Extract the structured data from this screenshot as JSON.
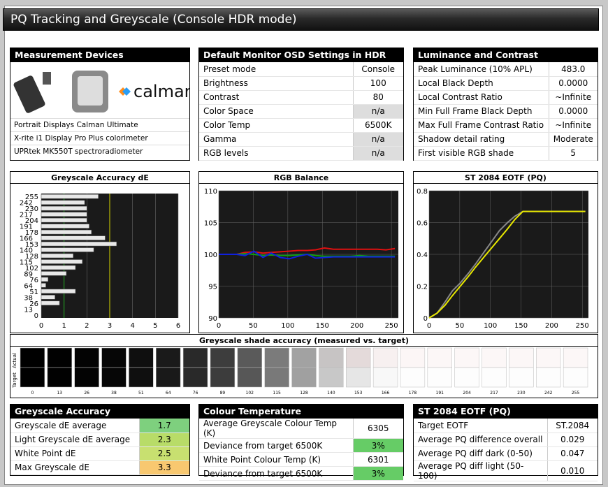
{
  "title": "PQ Tracking and Greyscale (Console HDR mode)",
  "devices": {
    "header": "Measurement Devices",
    "logo_text": "calman",
    "items": [
      "Portrait Displays Calman Ultimate",
      "X-rite i1 Display Pro Plus colorimeter",
      "UPRtek MK550T spectroradiometer"
    ]
  },
  "osd": {
    "header": "Default Monitor OSD Settings in HDR mode",
    "rows": [
      {
        "label": "Preset mode",
        "value": "Console",
        "na": false
      },
      {
        "label": "Brightness",
        "value": "100",
        "na": false
      },
      {
        "label": "Contrast",
        "value": "80",
        "na": false
      },
      {
        "label": "Color Space",
        "value": "n/a",
        "na": true
      },
      {
        "label": "Color Temp",
        "value": "6500K",
        "na": false
      },
      {
        "label": "Gamma",
        "value": "n/a",
        "na": true
      },
      {
        "label": "RGB levels",
        "value": "n/a",
        "na": true
      }
    ]
  },
  "lum": {
    "header": "Luminance and Contrast",
    "rows": [
      {
        "label": "Peak Luminance (10% APL)",
        "value": "483.0"
      },
      {
        "label": "Local Black Depth",
        "value": "0.0000"
      },
      {
        "label": "Local Contrast Ratio",
        "value": "~Infinite"
      },
      {
        "label": "Min Full Frame Black Depth",
        "value": "0.0000"
      },
      {
        "label": "Max Full Frame Contrast Ratio",
        "value": "~Infinite"
      },
      {
        "label": "Shadow detail rating",
        "value": "Moderate"
      },
      {
        "label": "First visible RGB shade",
        "value": "5"
      }
    ]
  },
  "chart_data": [
    {
      "type": "bar",
      "title": "Greyscale Accuracy dE",
      "categories": [
        "0",
        "13",
        "26",
        "38",
        "51",
        "64",
        "76",
        "89",
        "102",
        "115",
        "128",
        "140",
        "153",
        "166",
        "178",
        "191",
        "204",
        "217",
        "230",
        "242",
        "255"
      ],
      "values": [
        0,
        0,
        0.8,
        0.6,
        1.5,
        0.2,
        0.3,
        1.1,
        1.5,
        1.8,
        1.4,
        2.3,
        3.3,
        2.8,
        2.2,
        2.1,
        2.0,
        2.0,
        2.0,
        1.9,
        2.5
      ],
      "xlim": [
        0,
        6
      ],
      "xticks": [
        0,
        1,
        2,
        3,
        4,
        5,
        6
      ],
      "ref_lines": [
        {
          "x": 1,
          "color": "#22aa22"
        },
        {
          "x": 3,
          "color": "#d8d800"
        }
      ]
    },
    {
      "type": "line",
      "title": "RGB Balance",
      "x": [
        0,
        13,
        26,
        38,
        51,
        64,
        76,
        89,
        102,
        115,
        128,
        140,
        153,
        166,
        178,
        191,
        204,
        217,
        230,
        242,
        255
      ],
      "series": [
        {
          "color": "#e01010",
          "values": [
            100,
            100,
            100,
            100.3,
            100.4,
            100.2,
            100.3,
            100.4,
            100.5,
            100.6,
            100.6,
            100.7,
            101.0,
            100.8,
            100.8,
            100.8,
            100.8,
            100.8,
            100.8,
            100.7,
            100.9
          ]
        },
        {
          "color": "#10a010",
          "values": [
            100,
            100,
            100,
            100.1,
            100,
            99.8,
            99.9,
            99.8,
            99.8,
            99.9,
            100,
            99.8,
            99.7,
            99.7,
            99.7,
            99.7,
            99.8,
            99.7,
            99.7,
            99.7,
            99.7
          ]
        },
        {
          "color": "#1020e0",
          "values": [
            100,
            100,
            100,
            99.8,
            100.5,
            99.5,
            100.2,
            99.5,
            99.3,
            99.7,
            100.0,
            99.4,
            99.5,
            99.6,
            99.6,
            99.6,
            99.6,
            99.6,
            99.6,
            99.6,
            99.6
          ]
        }
      ],
      "ylim": [
        90,
        110
      ],
      "yticks": [
        90,
        95,
        100,
        105,
        110
      ],
      "xticks": [
        0,
        50,
        100,
        150,
        200,
        250
      ]
    },
    {
      "type": "line",
      "title": "ST 2084 EOTF (PQ)",
      "x": [
        0,
        13,
        26,
        38,
        51,
        64,
        76,
        89,
        102,
        115,
        128,
        140,
        153,
        166,
        178,
        191,
        204,
        217,
        230,
        242,
        255
      ],
      "series": [
        {
          "color": "#888888",
          "values": [
            0,
            0.03,
            0.1,
            0.17,
            0.22,
            0.28,
            0.34,
            0.41,
            0.48,
            0.55,
            0.6,
            0.64,
            0.67,
            0.67,
            0.67,
            0.67,
            0.67,
            0.67,
            0.67,
            0.67,
            0.67
          ]
        },
        {
          "color": "#e8e800",
          "values": [
            0,
            0.03,
            0.08,
            0.14,
            0.2,
            0.26,
            0.32,
            0.38,
            0.44,
            0.5,
            0.56,
            0.62,
            0.67,
            0.67,
            0.67,
            0.67,
            0.67,
            0.67,
            0.67,
            0.67,
            0.67
          ]
        }
      ],
      "ylim": [
        0,
        0.8
      ],
      "yticks": [
        0,
        0.2,
        0.4,
        0.6,
        0.8
      ],
      "xticks": [
        0,
        50,
        100,
        150,
        200,
        250
      ]
    }
  ],
  "shades": {
    "title": "Greyscale shade accuracy (measured vs. target)",
    "actual_label": "Actual",
    "target_label": "Target",
    "items": [
      {
        "label": "0",
        "actual": "#000000",
        "target": "#000000"
      },
      {
        "label": "13",
        "actual": "#010101",
        "target": "#010101"
      },
      {
        "label": "26",
        "actual": "#030303",
        "target": "#030303"
      },
      {
        "label": "38",
        "actual": "#060606",
        "target": "#060606"
      },
      {
        "label": "51",
        "actual": "#0f0f0f",
        "target": "#0f0f0f"
      },
      {
        "label": "64",
        "actual": "#1a1a1a",
        "target": "#191919"
      },
      {
        "label": "76",
        "actual": "#292929",
        "target": "#292929"
      },
      {
        "label": "89",
        "actual": "#3d3d3d",
        "target": "#3c3c3c"
      },
      {
        "label": "102",
        "actual": "#5a5a5a",
        "target": "#575757"
      },
      {
        "label": "115",
        "actual": "#7b7b7b",
        "target": "#797979"
      },
      {
        "label": "128",
        "actual": "#a2a2a2",
        "target": "#a0a0a0"
      },
      {
        "label": "140",
        "actual": "#c7c4c4",
        "target": "#c8c8c8"
      },
      {
        "label": "153",
        "actual": "#e4dada",
        "target": "#e6e6e6"
      },
      {
        "label": "166",
        "actual": "#f7f0f0",
        "target": "#f8f8f8"
      },
      {
        "label": "178",
        "actual": "#fcf6f6",
        "target": "#fdfdfd"
      },
      {
        "label": "191",
        "actual": "#fcf7f7",
        "target": "#fdfdfd"
      },
      {
        "label": "204",
        "actual": "#fcf7f7",
        "target": "#fdfdfd"
      },
      {
        "label": "217",
        "actual": "#fcf7f7",
        "target": "#fdfdfd"
      },
      {
        "label": "230",
        "actual": "#fcf7f7",
        "target": "#fdfdfd"
      },
      {
        "label": "242",
        "actual": "#fcf7f7",
        "target": "#fdfdfd"
      },
      {
        "label": "255",
        "actual": "#fcf7f7",
        "target": "#fdfdfd"
      }
    ]
  },
  "gs": {
    "header": "Greyscale Accuracy",
    "rows": [
      {
        "label": "Greyscale dE average",
        "value": "1.7",
        "color": "#7ed07e"
      },
      {
        "label": "Light Greyscale dE average",
        "value": "2.3",
        "color": "#b8dc68"
      },
      {
        "label": "White Point dE",
        "value": "2.5",
        "color": "#c8e070"
      },
      {
        "label": "Max Greyscale dE",
        "value": "3.3",
        "color": "#f8c870"
      }
    ]
  },
  "ct": {
    "header": "Colour Temperature",
    "rows": [
      {
        "label": "Average Greyscale Colour Temp (K)",
        "value": "6305",
        "color": "#ffffff"
      },
      {
        "label": "Deviance from target 6500K",
        "value": "3%",
        "color": "#66cc66"
      },
      {
        "label": "White Point Colour Temp (K)",
        "value": "6301",
        "color": "#ffffff"
      },
      {
        "label": "Deviance from target 6500K",
        "value": "3%",
        "color": "#66cc66"
      }
    ]
  },
  "eotf": {
    "header": "ST 2084 EOTF (PQ)",
    "rows": [
      {
        "label": "Target EOTF",
        "value": "ST.2084"
      },
      {
        "label": "Average PQ difference overall",
        "value": "0.029"
      },
      {
        "label": "Average PQ diff dark (0-50)",
        "value": "0.047"
      },
      {
        "label": "Average PQ diff light (50-100)",
        "value": "0.010"
      }
    ]
  }
}
